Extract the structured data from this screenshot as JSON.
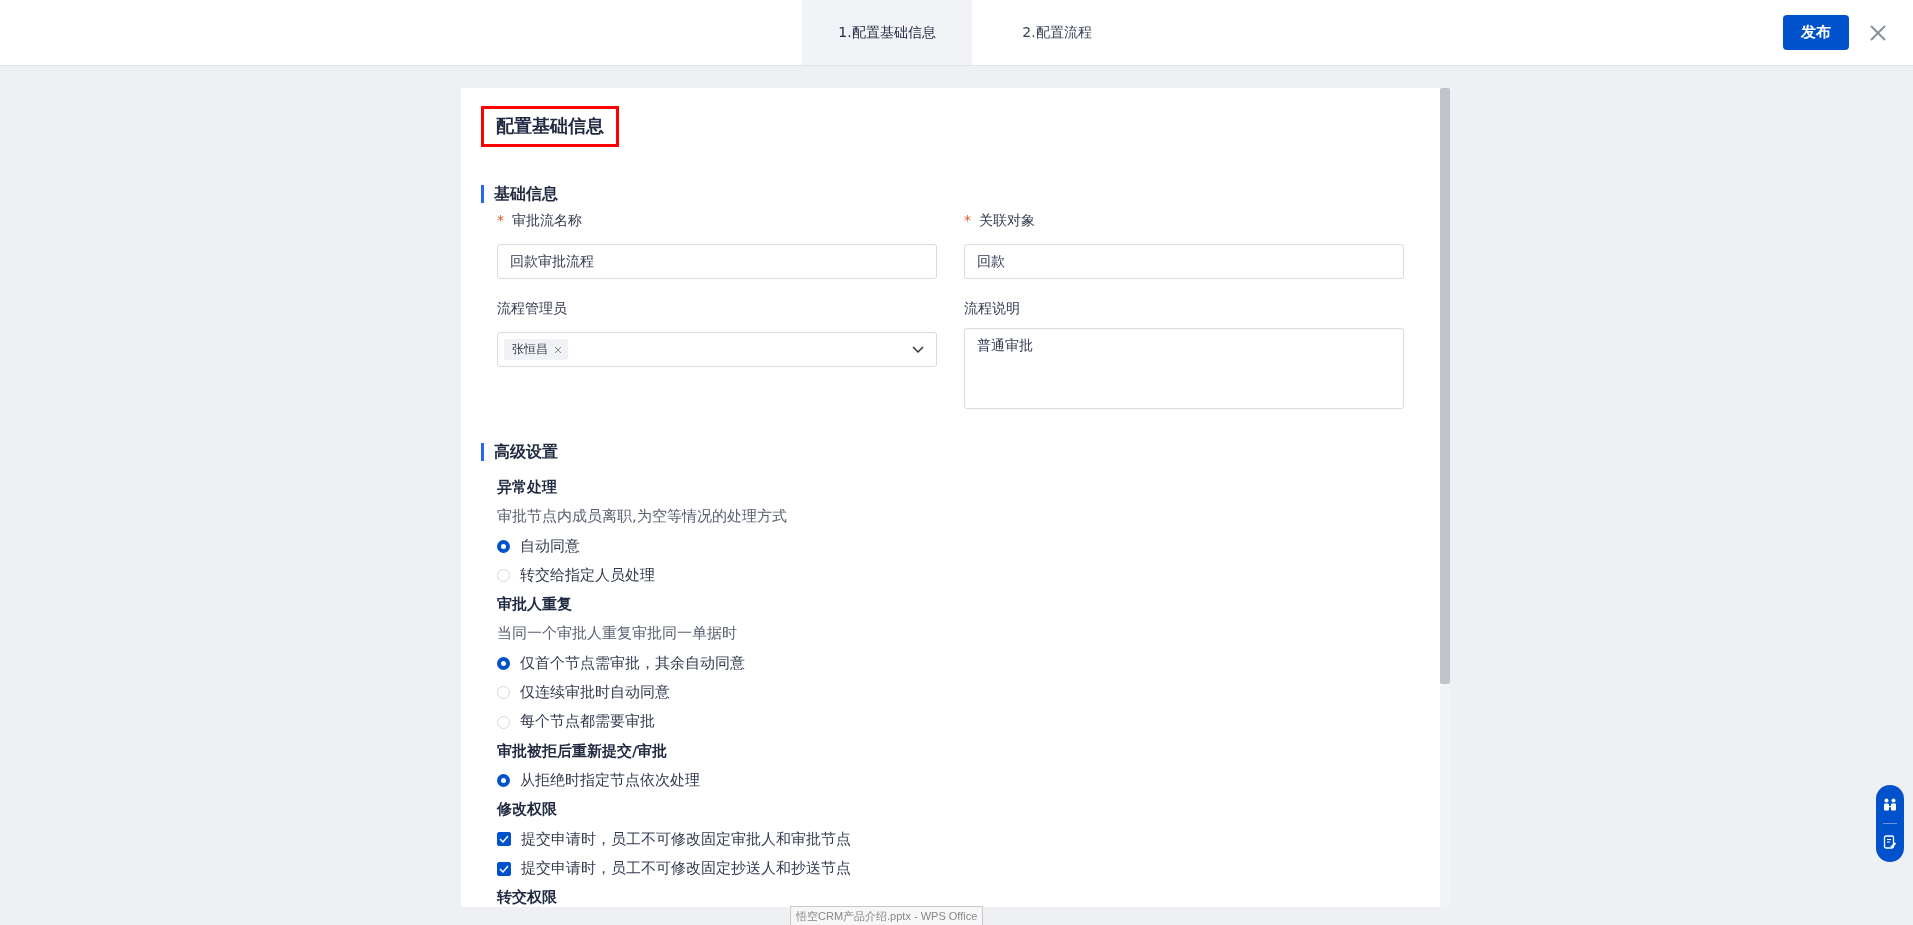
{
  "header": {
    "steps": [
      {
        "label": "1.配置基础信息",
        "selected": true
      },
      {
        "label": "2.配置流程",
        "selected": false
      }
    ],
    "publish_button": "发布"
  },
  "card": {
    "title": "配置基础信息",
    "basic": {
      "heading": "基础信息",
      "fields": [
        {
          "kind": "text",
          "label": "审批流名称",
          "required_mark": "*",
          "value": "回款审批流程"
        },
        {
          "kind": "text",
          "label": "关联对象",
          "required_mark": "*",
          "value": "回款"
        },
        {
          "kind": "tags",
          "label": "流程管理员",
          "tags": [
            "张恒昌"
          ]
        },
        {
          "kind": "textarea",
          "label": "流程说明",
          "value": "普通审批"
        }
      ]
    },
    "advanced": {
      "heading": "高级设置",
      "groups": [
        {
          "title": "异常处理",
          "description": "审批节点内成员离职,为空等情况的处理方式",
          "options": [
            {
              "kind": "radio",
              "label": "自动同意",
              "selected": true
            },
            {
              "kind": "radio",
              "label": "转交给指定人员处理",
              "selected": false
            }
          ]
        },
        {
          "title": "审批人重复",
          "description": "当同一个审批人重复审批同一单据时",
          "options": [
            {
              "kind": "radio",
              "label": "仅首个节点需审批，其余自动同意",
              "selected": true
            },
            {
              "kind": "radio",
              "label": "仅连续审批时自动同意",
              "selected": false
            },
            {
              "kind": "radio",
              "label": "每个节点都需要审批",
              "selected": false
            }
          ]
        },
        {
          "title": "审批被拒后重新提交/审批",
          "options": [
            {
              "kind": "radio",
              "label": "从拒绝时指定节点依次处理",
              "selected": true
            }
          ]
        },
        {
          "title": "修改权限",
          "options": [
            {
              "kind": "checkbox",
              "label": "提交申请时，员工不可修改固定审批人和审批节点",
              "checked": true
            },
            {
              "kind": "checkbox",
              "label": "提交申请时，员工不可修改固定抄送人和抄送节点",
              "checked": true
            }
          ]
        },
        {
          "title": "转交权限"
        }
      ]
    }
  },
  "taskbar_tooltip": "悟空CRM产品介绍.pptx - WPS Office"
}
